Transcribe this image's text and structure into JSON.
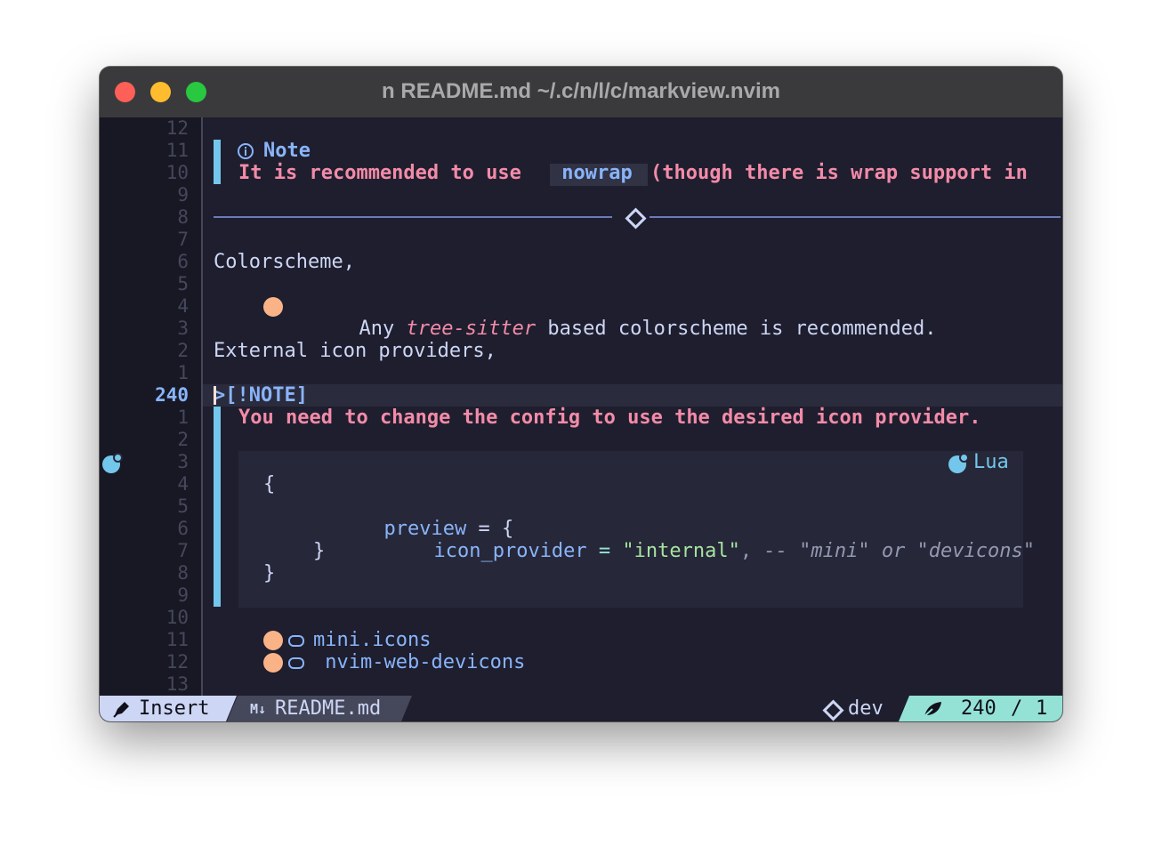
{
  "window": {
    "title": "n README.md ~/.c/n/l/c/markview.nvim"
  },
  "gutter": {
    "line_numbers": [
      "12",
      "11",
      "10",
      "9",
      "8",
      "7",
      "6",
      "5",
      "4",
      "3",
      "2",
      "1",
      "240",
      "1",
      "2",
      "3",
      "4",
      "5",
      "6",
      "7",
      "8",
      "9",
      "10",
      "11",
      "12",
      "13"
    ],
    "current_index": 12
  },
  "content": {
    "note1_title": "Note",
    "note1_line_prefix": "It is recommended to use ",
    "note1_code": " nowrap ",
    "note1_line_suffix": "(though there is wrap support in",
    "colorscheme_heading": "Colorscheme,",
    "bullet1_pre": "Any ",
    "bullet1_em": "tree-sitter",
    "bullet1_post": " based colorscheme is recommended.",
    "icons_heading": "External icon providers,",
    "note2_raw": ">[!NOTE]",
    "note2_line": "You need to change the config to use the desired icon provider.",
    "code_lang": "Lua",
    "code_open": "{",
    "code_preview": "preview",
    "code_eq": " = {",
    "code_key": "icon_provider",
    "code_eq2": " = ",
    "code_str": "\"internal\"",
    "code_comma": ",",
    "code_comment": " -- \"mini\" or \"devicons\"",
    "code_inner_close": "}",
    "code_close": "}",
    "link1": "mini.icons",
    "link2": " nvim-web-devicons"
  },
  "statusline": {
    "mode": "Insert",
    "file_icon": "M↓",
    "file": "README.md",
    "branch": "dev",
    "line": "240",
    "sep": "/",
    "col": "1"
  },
  "colors": {
    "background": "#1e1e2e",
    "note_blue": "#89b4fa",
    "text_pink": "#f38ba8",
    "bullet_peach": "#fab387",
    "accent_teal": "#94e2d5"
  }
}
